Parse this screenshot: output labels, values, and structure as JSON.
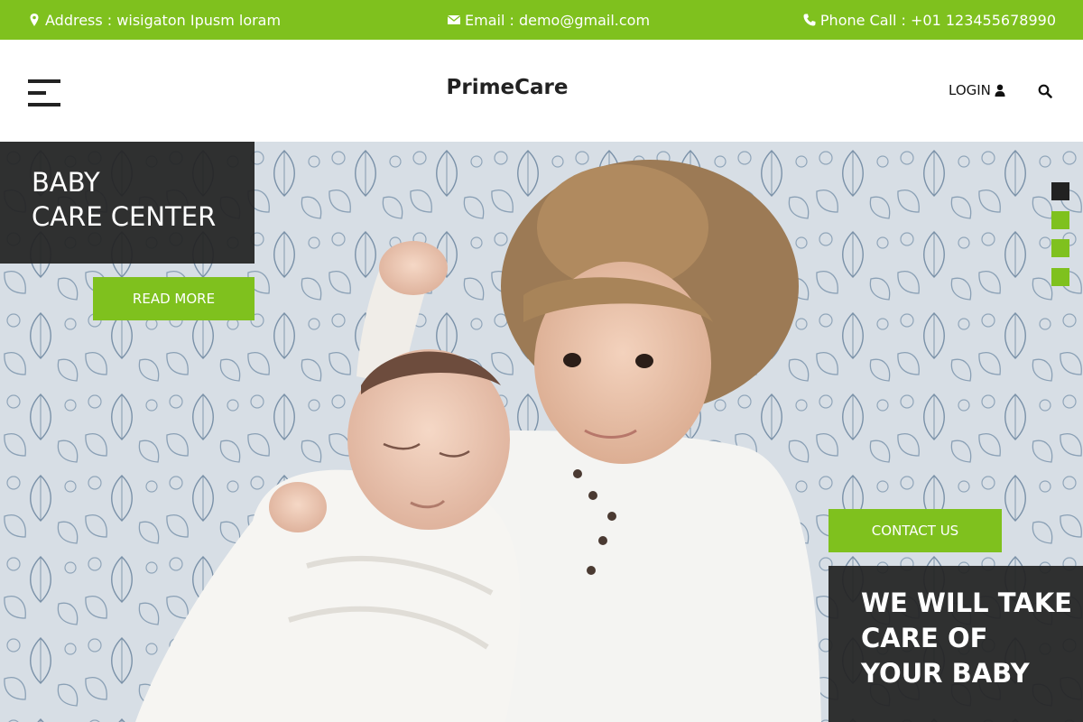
{
  "topbar": {
    "address": "Address : wisigaton Ipusm loram",
    "email": "Email : demo@gmail.com",
    "phone": "Phone Call : +01 123455678990"
  },
  "header": {
    "brand": "PrimeCare",
    "login_label": "LOGIN"
  },
  "hero": {
    "title_line1": "BABY",
    "title_line2": "CARE CENTER",
    "read_more_label": "READ MORE",
    "contact_label": "CONTACT US",
    "promo_line1": "WE WILL TAKE",
    "promo_line2": "CARE OF",
    "promo_line3": "YOUR BABY",
    "slider_dots": [
      {
        "active": true
      },
      {
        "active": false
      },
      {
        "active": false
      },
      {
        "active": false
      }
    ]
  },
  "icons": {
    "address": "map-marker-icon",
    "email": "envelope-icon",
    "phone": "phone-icon",
    "login": "user-icon",
    "search": "search-icon",
    "menu": "menu-icon"
  },
  "colors": {
    "accent": "#7fc11e",
    "dark": "#222222",
    "white": "#ffffff"
  }
}
